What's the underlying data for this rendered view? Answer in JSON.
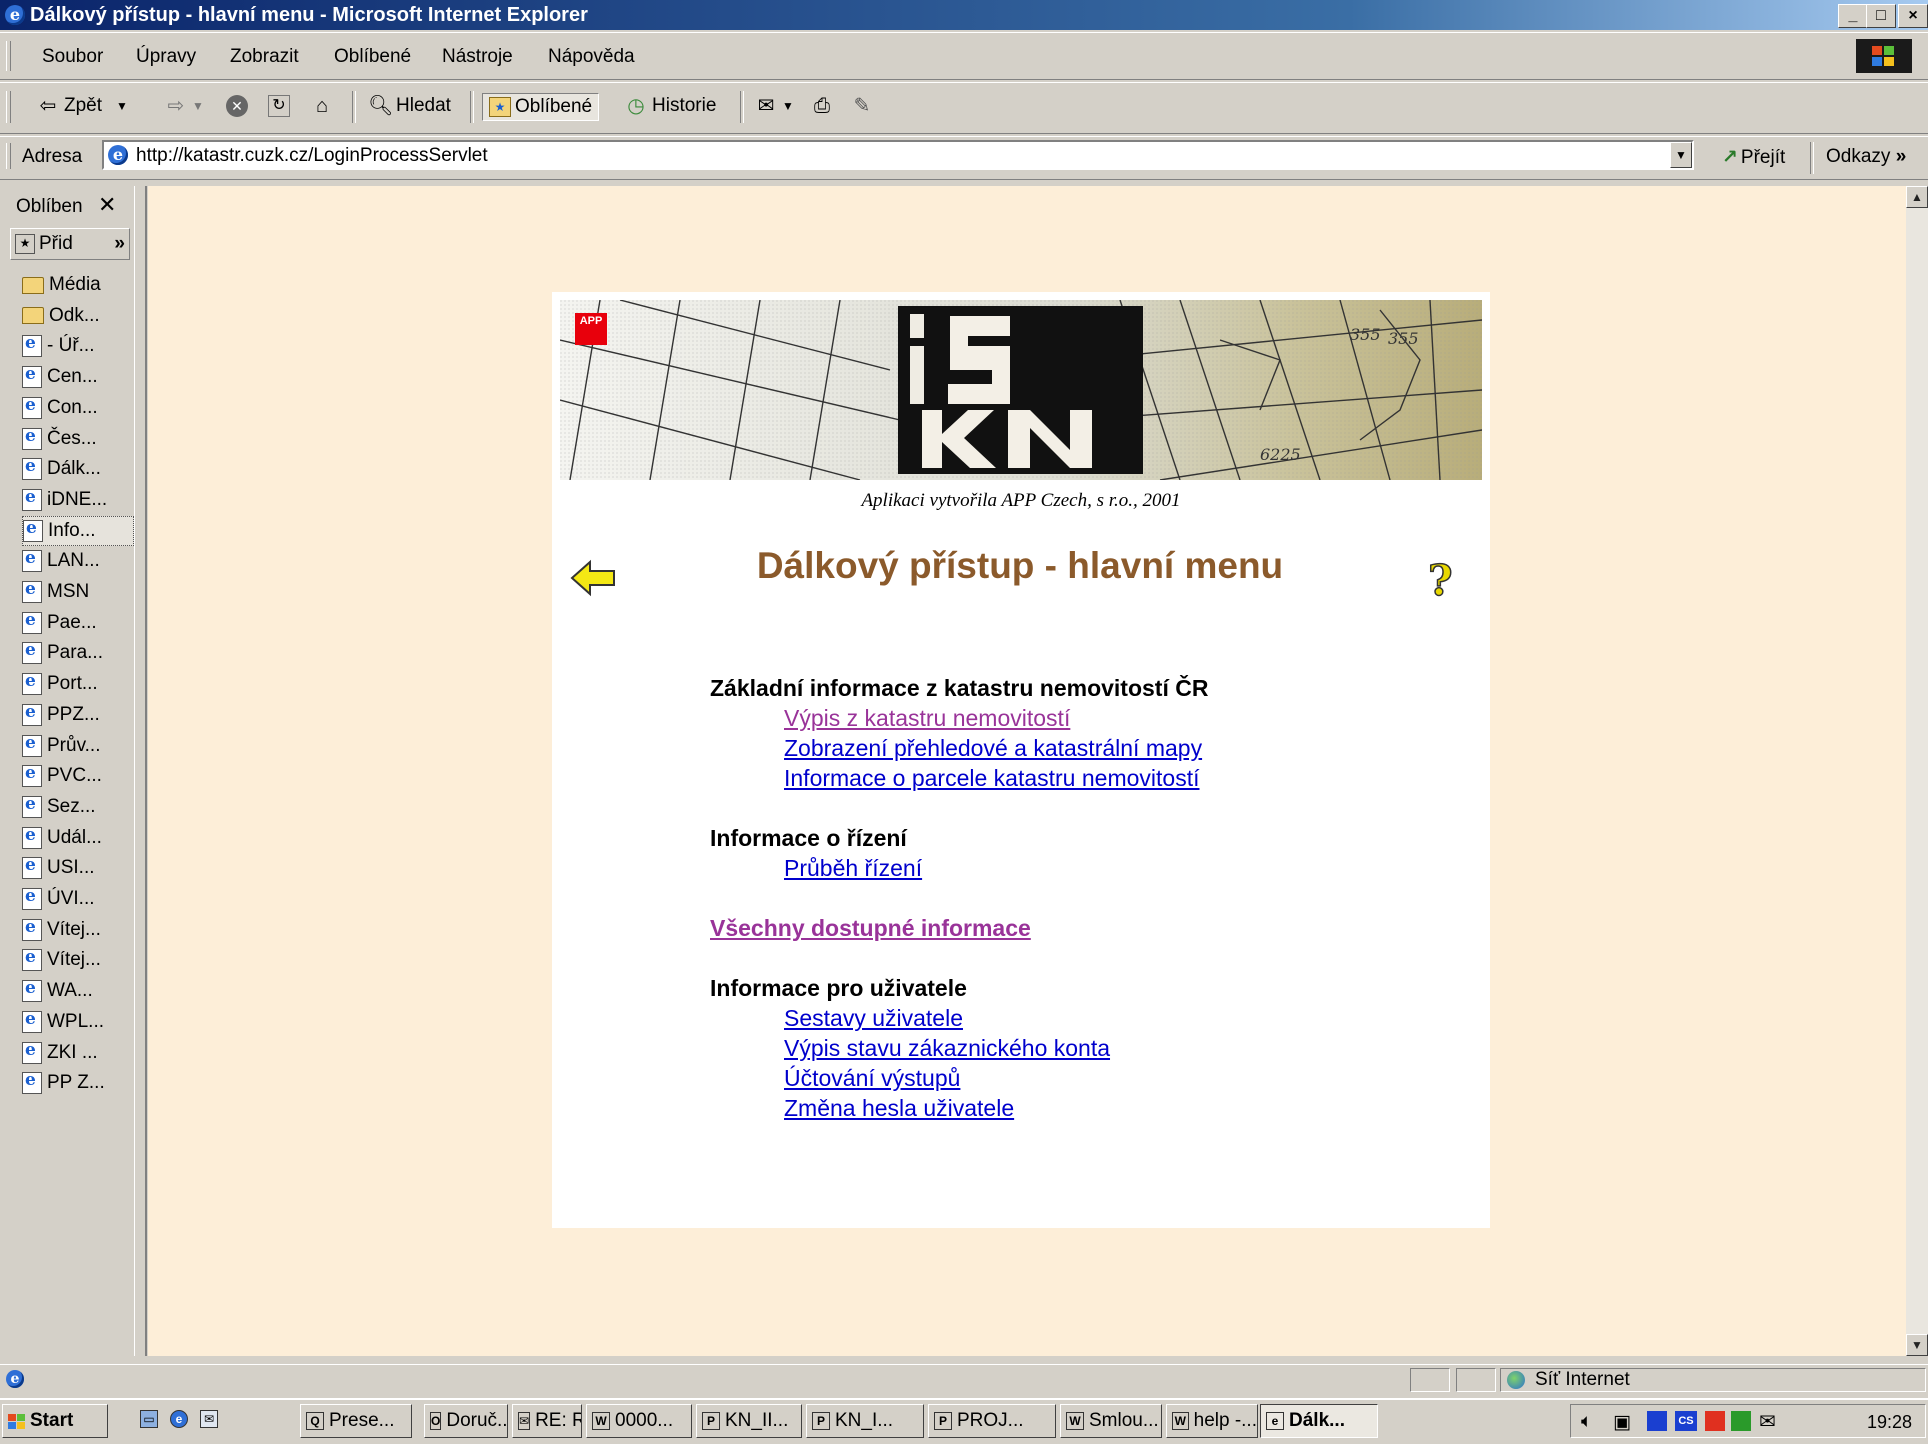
{
  "window": {
    "title": "Dálkový přístup - hlavní menu - Microsoft Internet Explorer",
    "controls": {
      "minimize": "_",
      "maximize": "□",
      "close": "×"
    }
  },
  "menubar": [
    "Soubor",
    "Úpravy",
    "Zobrazit",
    "Oblíbené",
    "Nástroje",
    "Nápověda"
  ],
  "toolbar": {
    "back": "Zpět",
    "search": "Hledat",
    "favorites": "Oblíbené",
    "history": "Historie"
  },
  "address": {
    "label": "Adresa",
    "url": "http://katastr.cuzk.cz/LoginProcessServlet",
    "go": "Přejít",
    "links": "Odkazy"
  },
  "favorites_pane": {
    "title": "Oblíben",
    "add": "Přid",
    "items": [
      {
        "label": "Média",
        "type": "folder"
      },
      {
        "label": "Odk...",
        "type": "folder"
      },
      {
        "label": "- Úř...",
        "type": "page"
      },
      {
        "label": "Cen...",
        "type": "page"
      },
      {
        "label": "Con...",
        "type": "page"
      },
      {
        "label": "Čes...",
        "type": "page"
      },
      {
        "label": "Dálk...",
        "type": "page"
      },
      {
        "label": "iDNE...",
        "type": "page"
      },
      {
        "label": "Info...",
        "type": "page",
        "selected": true
      },
      {
        "label": "LAN...",
        "type": "page"
      },
      {
        "label": "MSN",
        "type": "page"
      },
      {
        "label": "Pae...",
        "type": "page"
      },
      {
        "label": "Para...",
        "type": "page"
      },
      {
        "label": "Port...",
        "type": "page"
      },
      {
        "label": "PPZ...",
        "type": "page"
      },
      {
        "label": "Prův...",
        "type": "page"
      },
      {
        "label": "PVC...",
        "type": "page"
      },
      {
        "label": "Sez...",
        "type": "page"
      },
      {
        "label": "Udál...",
        "type": "page"
      },
      {
        "label": "USI...",
        "type": "page"
      },
      {
        "label": "ÚVI...",
        "type": "page"
      },
      {
        "label": "Vítej...",
        "type": "page"
      },
      {
        "label": "Vítej...",
        "type": "page"
      },
      {
        "label": "WA...",
        "type": "page"
      },
      {
        "label": "WPL...",
        "type": "page"
      },
      {
        "label": "ZKI ...",
        "type": "page"
      },
      {
        "label": "PP Z...",
        "type": "page"
      }
    ]
  },
  "page": {
    "banner_logo_letters": [
      "i",
      "S",
      "K",
      "N"
    ],
    "app_badge": "APP",
    "credit": "Aplikaci vytvořila APP Czech, s r.o., 2001",
    "heading": "Dálkový přístup - hlavní menu",
    "help_icon": "?",
    "sections": [
      {
        "title": "Základní informace z katastru nemovitostí ČR",
        "links": [
          {
            "text": "Výpis z katastru nemovitostí",
            "visited": true
          },
          {
            "text": "Zobrazení přehledové a katastrální mapy",
            "visited": false
          },
          {
            "text": "Informace o parcele katastru nemovitostí",
            "visited": false
          }
        ]
      },
      {
        "title": "Informace o řízení",
        "links": [
          {
            "text": "Průběh řízení",
            "visited": false
          }
        ]
      },
      {
        "title": "Všechny dostupné informace",
        "is_link": true,
        "links": []
      },
      {
        "title": "Informace pro uživatele",
        "links": [
          {
            "text": "Sestavy uživatele",
            "visited": false
          },
          {
            "text": "Výpis stavu zákaznického konta",
            "visited": false
          },
          {
            "text": "Účtování výstupů",
            "visited": false
          },
          {
            "text": "Změna hesla uživatele",
            "visited": false
          }
        ]
      }
    ]
  },
  "statusbar": {
    "zone": "Síť Internet"
  },
  "taskbar": {
    "start": "Start",
    "tasks": [
      {
        "label": "Prese...",
        "icon": "Q"
      },
      {
        "label": "Doruč...",
        "icon": "O"
      },
      {
        "label": "RE: R...",
        "icon": "✉"
      },
      {
        "label": "0000...",
        "icon": "W"
      },
      {
        "label": "KN_II...",
        "icon": "P"
      },
      {
        "label": "KN_I...",
        "icon": "P"
      },
      {
        "label": "PROJ...",
        "icon": "P"
      },
      {
        "label": "Smlou...",
        "icon": "W"
      },
      {
        "label": "help -...",
        "icon": "W"
      },
      {
        "label": "Dálk...",
        "icon": "e",
        "active": true
      }
    ],
    "tray": {
      "lang": "CS",
      "time": "19:28"
    }
  },
  "colors": {
    "page_bg": "#fdeed8",
    "heading": "#8b5a2b",
    "link": "#0000cc",
    "visited": "#993399",
    "titlebar": "#0a246a"
  }
}
